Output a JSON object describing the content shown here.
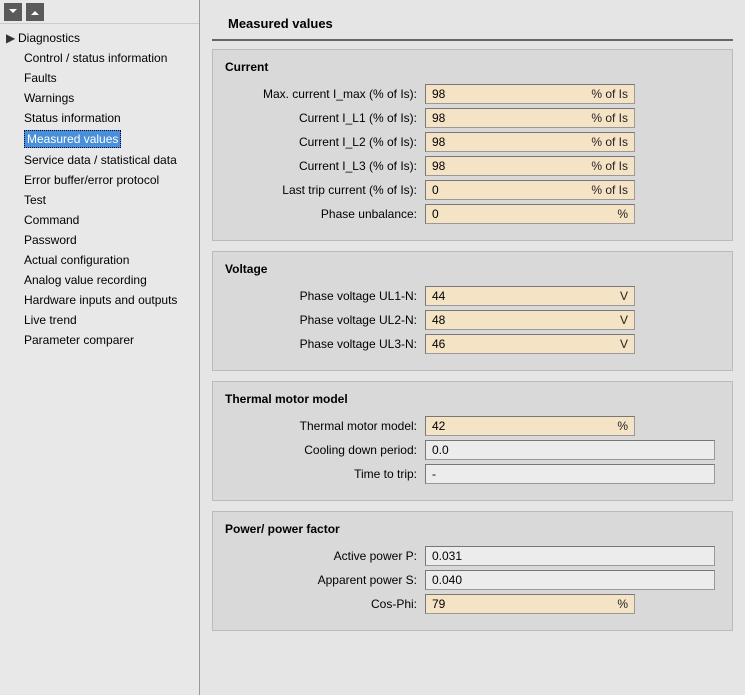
{
  "toolbar": {
    "btn1": "collapse-all",
    "btn2": "expand-all"
  },
  "nav": {
    "parent": {
      "label": "Diagnostics",
      "items": [
        {
          "label": "Control / status information"
        },
        {
          "label": "Faults"
        },
        {
          "label": "Warnings"
        },
        {
          "label": "Status information"
        },
        {
          "label": "Measured values",
          "selected": true
        },
        {
          "label": "Service data / statistical data"
        },
        {
          "label": "Error buffer/error protocol"
        },
        {
          "label": "Test"
        },
        {
          "label": "Command"
        },
        {
          "label": "Password"
        },
        {
          "label": "Actual configuration"
        },
        {
          "label": "Analog value recording"
        },
        {
          "label": "Hardware inputs and outputs"
        },
        {
          "label": "Live trend"
        },
        {
          "label": "Parameter comparer"
        }
      ]
    }
  },
  "page_title": "Measured values",
  "sections": {
    "current": {
      "title": "Current",
      "rows": [
        {
          "label": "Max. current I_max (% of Is):",
          "value": "98",
          "unit": "% of Is",
          "hl": true
        },
        {
          "label": "Current I_L1 (% of Is):",
          "value": "98",
          "unit": "% of Is",
          "hl": true
        },
        {
          "label": "Current I_L2 (% of Is):",
          "value": "98",
          "unit": "% of Is",
          "hl": true
        },
        {
          "label": "Current I_L3 (% of Is):",
          "value": "98",
          "unit": "% of Is",
          "hl": true
        },
        {
          "label": "Last trip current (% of Is):",
          "value": "0",
          "unit": "% of Is",
          "hl": true
        },
        {
          "label": "Phase unbalance:",
          "value": "0",
          "unit": "%",
          "hl": true
        }
      ]
    },
    "voltage": {
      "title": "Voltage",
      "rows": [
        {
          "label": "Phase voltage UL1-N:",
          "value": "44",
          "unit": "V",
          "hl": true
        },
        {
          "label": "Phase voltage UL2-N:",
          "value": "48",
          "unit": "V",
          "hl": true
        },
        {
          "label": "Phase voltage UL3-N:",
          "value": "46",
          "unit": "V",
          "hl": true
        }
      ]
    },
    "thermal": {
      "title": "Thermal motor model",
      "rows": [
        {
          "label": "Thermal motor model:",
          "value": "42",
          "unit": "%",
          "hl": true
        },
        {
          "label": "Cooling down period:",
          "value": "0.0",
          "unit": "",
          "hl": false
        },
        {
          "label": "Time to trip:",
          "value": "-",
          "unit": "",
          "hl": false
        }
      ]
    },
    "power": {
      "title": "Power/ power factor",
      "rows": [
        {
          "label": "Active power P:",
          "value": "0.031",
          "unit": "",
          "hl": false
        },
        {
          "label": "Apparent power S:",
          "value": "0.040",
          "unit": "",
          "hl": false
        },
        {
          "label": "Cos-Phi:",
          "value": "79",
          "unit": "%",
          "hl": true
        }
      ]
    }
  }
}
